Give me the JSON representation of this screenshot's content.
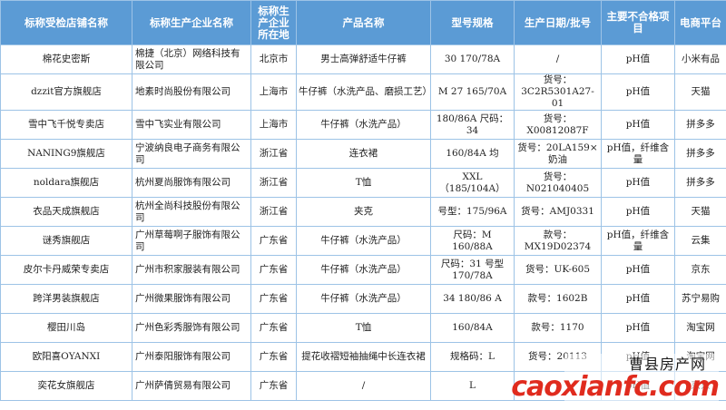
{
  "headers": [
    "标称受检店铺名称",
    "标称生产企业名称",
    "标称生产企业所在地",
    "产品名称",
    "型号规格",
    "生产日期/批号",
    "主要不合格项目",
    "电商平台"
  ],
  "rows": [
    [
      "棉花史密斯",
      "棉捷（北京）网络科技有限公司",
      "北京市",
      "男士高弹舒适牛仔裤",
      "30 170/78A",
      "/",
      "pH值",
      "小米有品"
    ],
    [
      "dzzit官方旗舰店",
      "地素时尚股份有限公司",
      "上海市",
      "牛仔裤（水洗产品、磨损工艺）",
      "M 27 165/70A",
      "货号：3C2R5301A27-01",
      "pH值",
      "天猫"
    ],
    [
      "雪中飞千悦专卖店",
      "雪中飞实业有限公司",
      "上海市",
      "牛仔裤（水洗产品）",
      "180/86A 尺码：34",
      "货号：X00812087F",
      "pH值",
      "拼多多"
    ],
    [
      "NANING9旗舰店",
      "宁波纳良电子商务有限公司",
      "浙江省",
      "连衣裙",
      "160/84A 均",
      "货号：20LA159×奶油",
      "pH值，纤维含量",
      "拼多多"
    ],
    [
      "noldara旗舰店",
      "杭州夏尚服饰有限公司",
      "浙江省",
      "T恤",
      "XXL（185/104A）",
      "货号：N021040405",
      "pH值",
      "拼多多"
    ],
    [
      "衣品天成旗舰店",
      "杭州全尚科技股份有限公司",
      "浙江省",
      "夹克",
      "号型：175/96A",
      "货号：AMJ0331",
      "pH值",
      "天猫"
    ],
    [
      "谜秀旗舰店",
      "广州草莓啊子服饰有限公司",
      "广东省",
      "牛仔裤（水洗产品）",
      "尺码：M 160/88A",
      "款号：MX19D02374",
      "pH值，纤维含量",
      "云集"
    ],
    [
      "皮尔卡丹威荣专卖店",
      "广州市积家服装有限公司",
      "广东省",
      "牛仔裤（水洗产品）",
      "尺码：31 号型170/78A",
      "货号：UK-605",
      "pH值",
      "京东"
    ],
    [
      "跨洋男装旗舰店",
      "广州微果服饰有限公司",
      "广东省",
      "牛仔裤（水洗产品）",
      "34 180/86 A",
      "款号：1602B",
      "pH值",
      "苏宁易购"
    ],
    [
      "樱田川岛",
      "广州色彩秀服饰有限公司",
      "广东省",
      "T恤",
      "160/84A",
      "款号：1170",
      "pH值",
      "淘宝网"
    ],
    [
      "欧阳喜OYANXI",
      "广州泰阳服饰有限公司",
      "广东省",
      "提花收褶短袖抽绳中长连衣裙",
      "规格码：L",
      "货号：20113",
      "pH值",
      "淘宝网"
    ],
    [
      "奕花女旗舰店",
      "广州萨倩贸易有限公司",
      "广东省",
      "/",
      "L",
      "/",
      "pH值",
      "京东"
    ]
  ],
  "watermark": {
    "top": "曹县房产网",
    "bottom": "caoxianfc.com"
  },
  "colors": {
    "header_bg": "#5b9bd5",
    "border": "#9dc3e6",
    "watermark_red": "#e02b1e"
  }
}
